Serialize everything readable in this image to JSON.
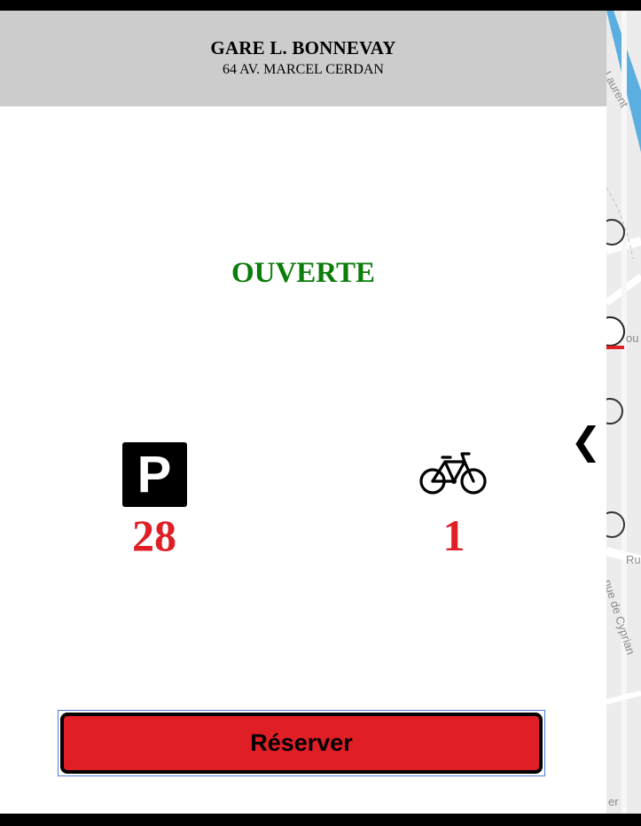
{
  "station": {
    "name": "GARE L. BONNEVAY",
    "address": "64 AV. MARCEL CERDAN",
    "status": "OUVERTE"
  },
  "stats": {
    "parking": {
      "icon": "parking-icon",
      "icon_letter": "P",
      "value": "28"
    },
    "bikes": {
      "icon": "bicycle-icon",
      "value": "1"
    }
  },
  "actions": {
    "reserve_label": "Réserver",
    "collapse_icon": "chevron-left-icon",
    "collapse_glyph": "❮"
  },
  "map": {
    "labels": [
      "e Laurent",
      "ou",
      "Ru",
      "nue de Cyprian",
      "er"
    ]
  },
  "colors": {
    "status": "#0b7d0b",
    "value": "#e01e26",
    "button": "#e01e26",
    "header_bg": "#cccccc"
  }
}
